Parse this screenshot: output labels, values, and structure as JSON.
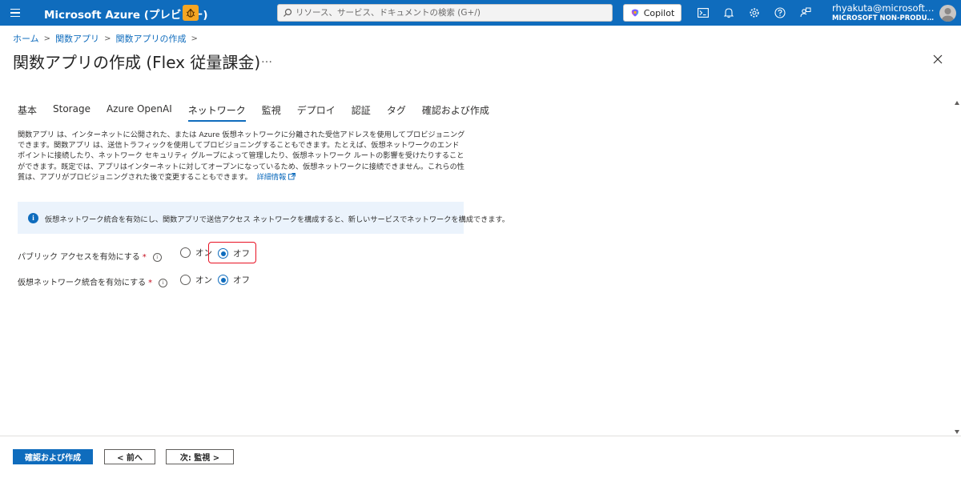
{
  "topbar": {
    "menu_icon": "hamburger-icon",
    "brand": "Microsoft Azure (プレビュー)",
    "bug_icon": "bug-icon",
    "search_placeholder": "リソース、サービス、ドキュメントの検索 (G+/)",
    "copilot_label": "Copilot",
    "icons": [
      "cloud-shell-icon",
      "bell-icon",
      "gear-icon",
      "help-icon",
      "feedback-icon"
    ],
    "user_name": "rhyakuta@microsoft.…",
    "user_org": "MICROSOFT NON-PRODUC…",
    "brand_color": "#0f6cbd"
  },
  "breadcrumb": [
    "ホーム",
    "関数アプリ",
    "関数アプリの作成"
  ],
  "page_title": "関数アプリの作成 (Flex 従量課金)",
  "more_label": "…",
  "tabs": [
    {
      "label": "基本"
    },
    {
      "label": "Storage"
    },
    {
      "label": "Azure OpenAI"
    },
    {
      "label": "ネットワーク",
      "active": true
    },
    {
      "label": "監視"
    },
    {
      "label": "デプロイ"
    },
    {
      "label": "認証"
    },
    {
      "label": "タグ"
    },
    {
      "label": "確認および作成"
    }
  ],
  "description": {
    "text": "関数アプリ は、インターネットに公開された、または Azure 仮想ネットワークに分離された受信アドレスを使用してプロビジョニングできます。関数アプリ は、送信トラフィックを使用してプロビジョニングすることもできます。たとえば、仮想ネットワークのエンドポイントに接続したり、ネットワーク セキュリティ グループによって管理したり、仮想ネットワーク ルートの影響を受けたりすることができます。既定では、アプリはインターネットに対してオープンになっているため、仮想ネットワークに接続できません。これらの性質は、アプリがプロビジョニングされた後で変更することもできます。",
    "link": "詳細情報"
  },
  "info_message": "仮想ネットワーク統合を有効にし、関数アプリで送信アクセス ネットワークを構成すると、新しいサービスでネットワークを構成できます。",
  "fields": {
    "public_access": {
      "label": "パブリック アクセスを有効にする",
      "required": "*",
      "on_label": "オン",
      "off_label": "オフ",
      "selected": "off"
    },
    "vnet_integration": {
      "label": "仮想ネットワーク統合を有効にする",
      "required": "*",
      "on_label": "オン",
      "off_label": "オフ",
      "selected": "off"
    }
  },
  "footer": {
    "review_create": "確認および作成",
    "previous": "< 前へ",
    "next": "次: 監視 >"
  }
}
